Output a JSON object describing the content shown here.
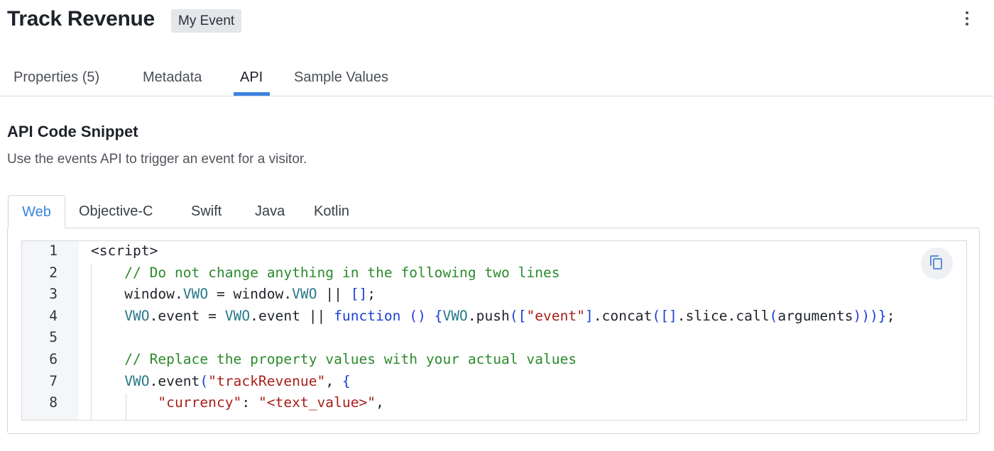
{
  "header": {
    "title": "Track Revenue",
    "event_badge": "My Event",
    "menu_icon": "kebab-menu-icon"
  },
  "tabs": [
    {
      "label": "Properties (5)",
      "active": false
    },
    {
      "label": "Metadata",
      "active": false
    },
    {
      "label": "API",
      "active": true
    },
    {
      "label": "Sample Values",
      "active": false
    }
  ],
  "section": {
    "title": "API Code Snippet",
    "description": "Use the events API to trigger an event for a visitor."
  },
  "lang_tabs": [
    {
      "label": "Web",
      "active": true
    },
    {
      "label": "Objective-C",
      "active": false
    },
    {
      "label": "Swift",
      "active": false
    },
    {
      "label": "Java",
      "active": false
    },
    {
      "label": "Kotlin",
      "active": false
    }
  ],
  "editor": {
    "copy_icon": "copy-icon",
    "lines": [
      {
        "number": "1",
        "text": "<script>"
      },
      {
        "number": "2",
        "text": "    // Do not change anything in the following two lines"
      },
      {
        "number": "3",
        "text": "    window.VWO = window.VWO || [];"
      },
      {
        "number": "4",
        "text": "    VWO.event = VWO.event || function () {VWO.push([\"event\"].concat([].slice.call(arguments)))};"
      },
      {
        "number": "5",
        "text": ""
      },
      {
        "number": "6",
        "text": "    // Replace the property values with your actual values"
      },
      {
        "number": "7",
        "text": "    VWO.event(\"trackRevenue\", {"
      },
      {
        "number": "8",
        "text": "        \"currency\": \"<text_value>\","
      }
    ]
  },
  "colors": {
    "accent": "#3b82e0",
    "comment": "#2c8a2c",
    "keyword": "#1c3fd1",
    "string": "#a8201a",
    "identifier": "#2a7a8c"
  }
}
